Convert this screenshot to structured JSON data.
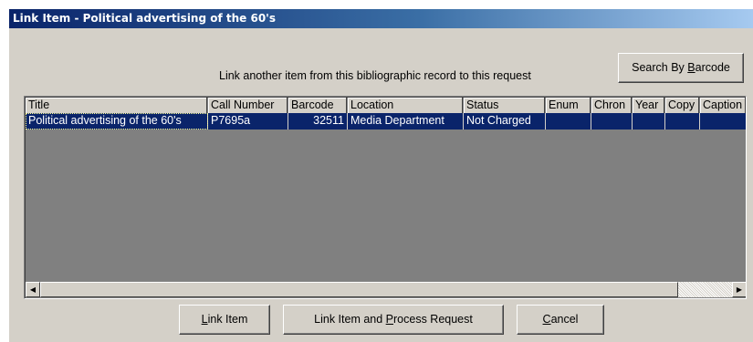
{
  "window": {
    "title": "Link Item - Political advertising of the 60's"
  },
  "prompt": "Link another item from this bibliographic record to this request",
  "buttons": {
    "search_barcode_pre": "Search By ",
    "search_barcode_u": "B",
    "search_barcode_post": "arcode",
    "link_u": "L",
    "link_post": "ink Item",
    "process_pre": "Link Item and ",
    "process_u": "P",
    "process_post": "rocess Request",
    "cancel_u": "C",
    "cancel_post": "ancel"
  },
  "table": {
    "columns": [
      "Title",
      "Call Number",
      "Barcode",
      "Location",
      "Status",
      "Enum",
      "Chron",
      "Year",
      "Copy",
      "Caption"
    ],
    "rows": [
      [
        "Political advertising of the 60's",
        "P7695a",
        "32511",
        "Media Department",
        "Not Charged",
        "",
        "",
        "",
        "",
        ""
      ]
    ]
  },
  "scrollbar": {
    "left_icon": "arrow-left-icon",
    "right_icon": "arrow-right-icon"
  }
}
